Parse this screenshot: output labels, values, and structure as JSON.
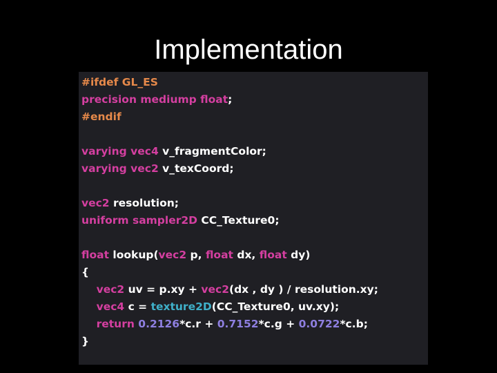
{
  "slide": {
    "title": "Implementation"
  },
  "code": {
    "lines": [
      [
        {
          "t": "#ifdef GL_ES",
          "c": "pp"
        }
      ],
      [
        {
          "t": "precision mediump float",
          "c": "kw"
        },
        {
          "t": ";",
          "c": "pl"
        }
      ],
      [
        {
          "t": "#endif",
          "c": "pp"
        }
      ],
      [],
      [
        {
          "t": "varying vec4 ",
          "c": "kw"
        },
        {
          "t": "v_fragmentColor;",
          "c": "pl"
        }
      ],
      [
        {
          "t": "varying vec2 ",
          "c": "kw"
        },
        {
          "t": "v_texCoord;",
          "c": "pl"
        }
      ],
      [],
      [
        {
          "t": "vec2 ",
          "c": "kw"
        },
        {
          "t": "resolution;",
          "c": "pl"
        }
      ],
      [
        {
          "t": "uniform sampler2D ",
          "c": "kw"
        },
        {
          "t": "CC_Texture0;",
          "c": "pl"
        }
      ],
      [],
      [
        {
          "t": "float ",
          "c": "kw"
        },
        {
          "t": "lookup(",
          "c": "pl"
        },
        {
          "t": "vec2 ",
          "c": "kw"
        },
        {
          "t": "p, ",
          "c": "pl"
        },
        {
          "t": "float ",
          "c": "kw"
        },
        {
          "t": "dx, ",
          "c": "pl"
        },
        {
          "t": "float ",
          "c": "kw"
        },
        {
          "t": "dy)",
          "c": "pl"
        }
      ],
      [
        {
          "t": "{",
          "c": "pl"
        }
      ],
      [
        {
          "t": "    ",
          "c": "pl"
        },
        {
          "t": "vec2 ",
          "c": "kw"
        },
        {
          "t": "uv = p.xy + ",
          "c": "pl"
        },
        {
          "t": "vec2",
          "c": "kw"
        },
        {
          "t": "(dx , dy ) / resolution.xy;",
          "c": "pl"
        }
      ],
      [
        {
          "t": "    ",
          "c": "pl"
        },
        {
          "t": "vec4 ",
          "c": "kw"
        },
        {
          "t": "c = ",
          "c": "pl"
        },
        {
          "t": "texture2D",
          "c": "fn"
        },
        {
          "t": "(CC_Texture0, uv.xy);",
          "c": "pl"
        }
      ],
      [
        {
          "t": "    ",
          "c": "pl"
        },
        {
          "t": "return ",
          "c": "kw"
        },
        {
          "t": "0.2126",
          "c": "num"
        },
        {
          "t": "*c.r + ",
          "c": "pl"
        },
        {
          "t": "0.7152",
          "c": "num"
        },
        {
          "t": "*c.g + ",
          "c": "pl"
        },
        {
          "t": "0.0722",
          "c": "num"
        },
        {
          "t": "*c.b;",
          "c": "pl"
        }
      ],
      [
        {
          "t": "}",
          "c": "pl"
        }
      ]
    ]
  },
  "colors": {
    "background": "#000000",
    "code_background": "#1f1f24",
    "preprocessor": "#e6894a",
    "keyword": "#d43fa0",
    "function": "#3fb0c9",
    "number": "#8e7fe0",
    "plain": "#ffffff"
  }
}
